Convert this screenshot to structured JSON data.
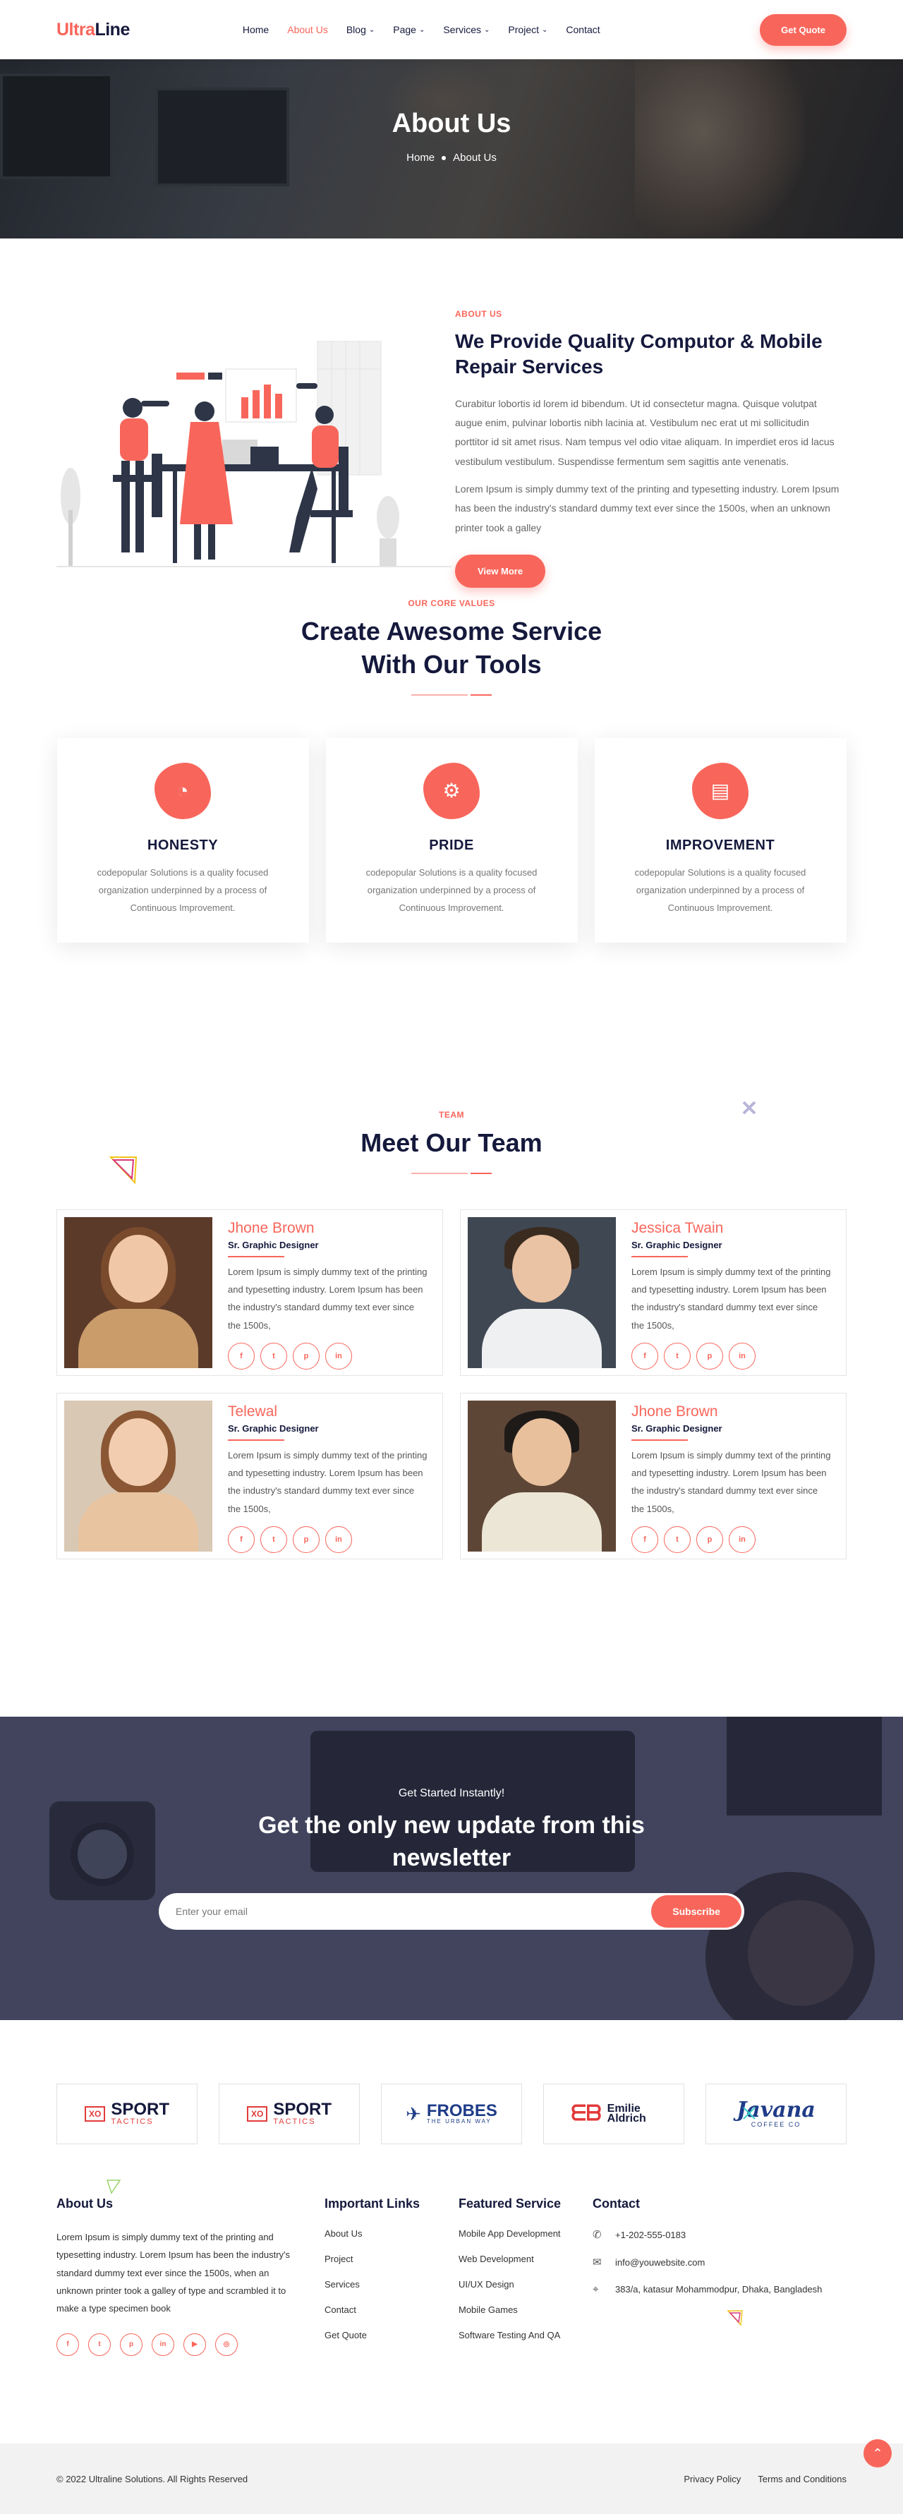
{
  "header": {
    "logo_part1": "Ultra",
    "logo_part2": "Line",
    "nav": [
      {
        "label": "Home"
      },
      {
        "label": "About Us"
      },
      {
        "label": "Blog"
      },
      {
        "label": "Page"
      },
      {
        "label": "Services"
      },
      {
        "label": "Project"
      },
      {
        "label": "Contact"
      }
    ],
    "cta": "Get Quote"
  },
  "hero": {
    "title": "About Us",
    "crumb_home": "Home",
    "crumb_current": "About Us"
  },
  "about": {
    "kicker": "ABOUT US",
    "title": "We Provide Quality Computor & Mobile Repair Services",
    "para1": "Curabitur lobortis id lorem id bibendum. Ut id consectetur magna. Quisque volutpat augue enim, pulvinar lobortis nibh lacinia at. Vestibulum nec erat ut mi sollicitudin porttitor id sit amet risus. Nam tempus vel odio vitae aliquam. In imperdiet eros id lacus vestibulum vestibulum. Suspendisse fermentum sem sagittis ante venenatis.",
    "para2": "Lorem Ipsum is simply dummy text of the printing and typesetting industry. Lorem Ipsum has been the industry's standard dummy text ever since the 1500s, when an unknown printer took a galley",
    "button": "View More"
  },
  "values": {
    "kicker": "OUR CORE VALUES",
    "title_line1": "Create Awesome Service",
    "title_line2": "With Our Tools",
    "cards": [
      {
        "title": "HONESTY",
        "text": "codepopular Solutions is a quality focused organization underpinned by a process of Continuous Improvement.",
        "icon": "pie-chart-icon"
      },
      {
        "title": "PRIDE",
        "text": "codepopular Solutions is a quality focused organization underpinned by a process of Continuous Improvement.",
        "icon": "settings-icon"
      },
      {
        "title": "IMPROVEMENT",
        "text": "codepopular Solutions is a quality focused organization underpinned by a process of Continuous Improvement.",
        "icon": "growth-chart-icon"
      }
    ]
  },
  "team": {
    "kicker": "TEAM",
    "title": "Meet Our Team",
    "members": [
      {
        "name": "Jhone Brown",
        "role": "Sr. Graphic Designer",
        "bio": "Lorem Ipsum is simply dummy text of the printing and typesetting industry. Lorem Ipsum has been the industry's standard dummy text ever since the 1500s,"
      },
      {
        "name": "Jessica Twain",
        "role": "Sr. Graphic Designer",
        "bio": "Lorem Ipsum is simply dummy text of the printing and typesetting industry. Lorem Ipsum has been the industry's standard dummy text ever since the 1500s,"
      },
      {
        "name": "Telewal",
        "role": "Sr. Graphic Designer",
        "bio": "Lorem Ipsum is simply dummy text of the printing and typesetting industry. Lorem Ipsum has been the industry's standard dummy text ever since the 1500s,"
      },
      {
        "name": "Jhone Brown",
        "role": "Sr. Graphic Designer",
        "bio": "Lorem Ipsum is simply dummy text of the printing and typesetting industry. Lorem Ipsum has been the industry's standard dummy text ever since the 1500s,"
      }
    ],
    "social_icons": [
      "facebook-icon",
      "twitter-icon",
      "pinterest-icon",
      "linkedin-icon"
    ]
  },
  "newsletter": {
    "kicker": "Get Started Instantly!",
    "title_line1": "Get the only new update from this",
    "title_line2": "newsletter",
    "placeholder": "Enter your email",
    "button": "Subscribe"
  },
  "brands": [
    {
      "name": "SPORT",
      "sub": "TACTICS"
    },
    {
      "name": "SPORT",
      "sub": "TACTICS"
    },
    {
      "name": "FROBES",
      "sub": "THE URBAN WAY"
    },
    {
      "name": "Emilie Aldrich",
      "sub": ""
    },
    {
      "name": "Javana",
      "sub": "COFFEE CO"
    }
  ],
  "footer": {
    "about_title": "About Us",
    "about_text": "Lorem Ipsum is simply dummy text of the printing and typesetting industry. Lorem Ipsum has been the industry's standard dummy text ever since the 1500s, when an unknown printer took a galley of type and scrambled it to make a type specimen book",
    "links_title": "Important Links",
    "links": [
      "About Us",
      "Project",
      "Services",
      "Contact",
      "Get Quote"
    ],
    "services_title": "Featured Service",
    "services": [
      "Mobile App Development",
      "Web Development",
      "UI/UX Design",
      "Mobile Games",
      "Software Testing And QA"
    ],
    "contact_title": "Contact",
    "phone": "+1-202-555-0183",
    "email": "info@youwebsite.com",
    "address": "383/a, katasur Mohammodpur, Dhaka, Bangladesh",
    "socials": [
      "facebook-icon",
      "twitter-icon",
      "pinterest-icon",
      "linkedin-icon",
      "youtube-icon",
      "dribbble-icon"
    ]
  },
  "bottom": {
    "copyright": "© 2022 Ultraline Solutions. All Rights Reserved",
    "privacy": "Privacy Policy",
    "terms": "Terms and Conditions"
  },
  "colors": {
    "accent": "#f8665b",
    "navy": "#15193c"
  }
}
